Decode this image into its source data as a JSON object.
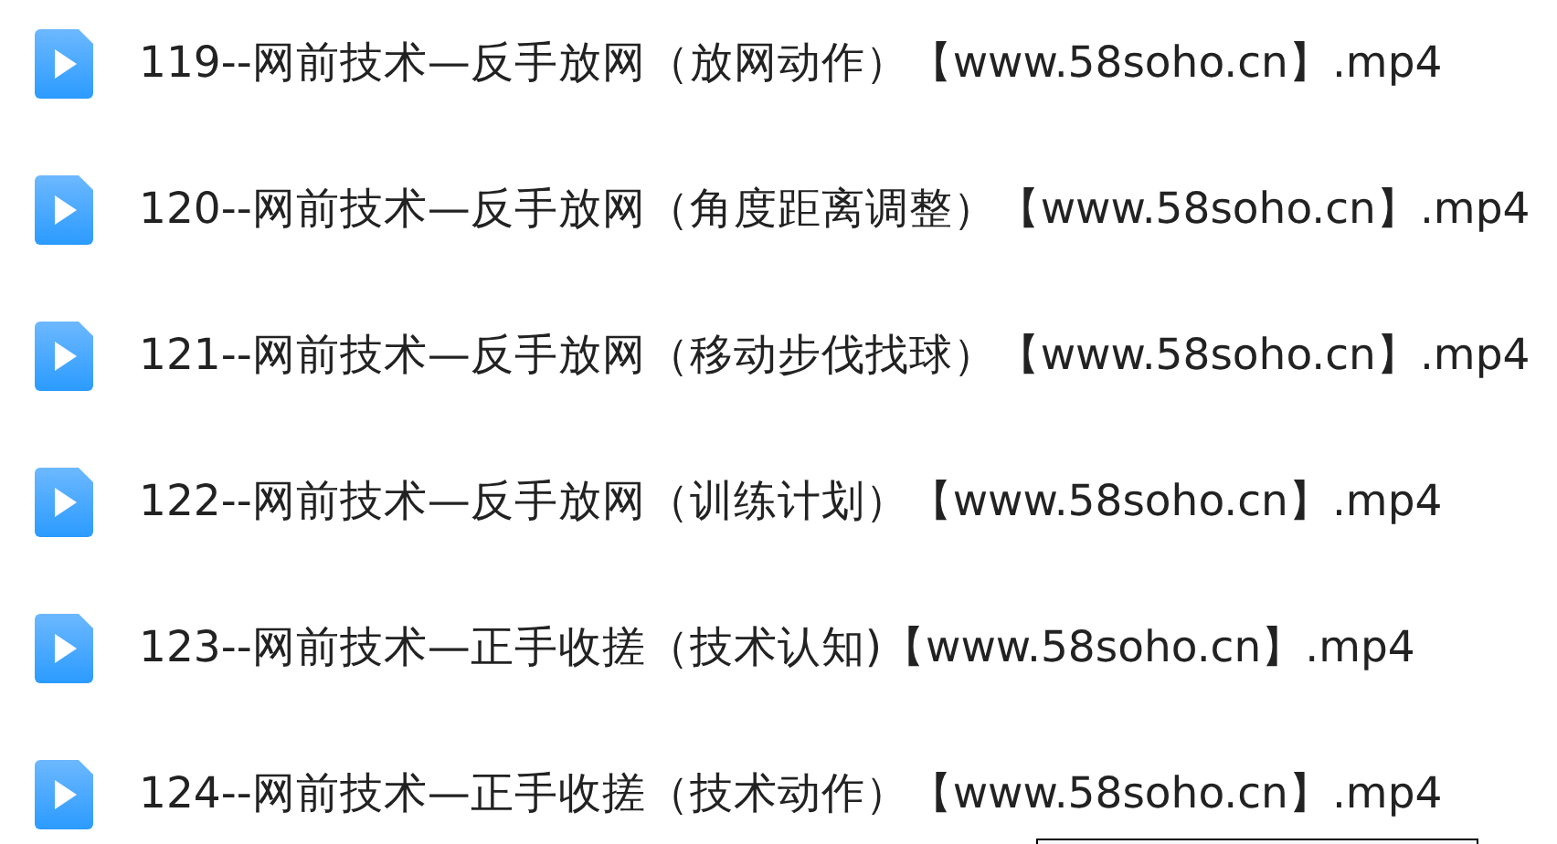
{
  "files": [
    {
      "name": "119--网前技术—反手放网（放网动作）【www.58soho.cn】.mp4"
    },
    {
      "name": "120--网前技术—反手放网（角度距离调整）【www.58soho.cn】.mp4"
    },
    {
      "name": "121--网前技术—反手放网（移动步伐找球）【www.58soho.cn】.mp4"
    },
    {
      "name": "122--网前技术—反手放网（训练计划）【www.58soho.cn】.mp4"
    },
    {
      "name": "123--网前技术—正手收搓（技术认知)【www.58soho.cn】.mp4"
    },
    {
      "name": "124--网前技术—正手收搓（技术动作）【www.58soho.cn】.mp4"
    }
  ]
}
